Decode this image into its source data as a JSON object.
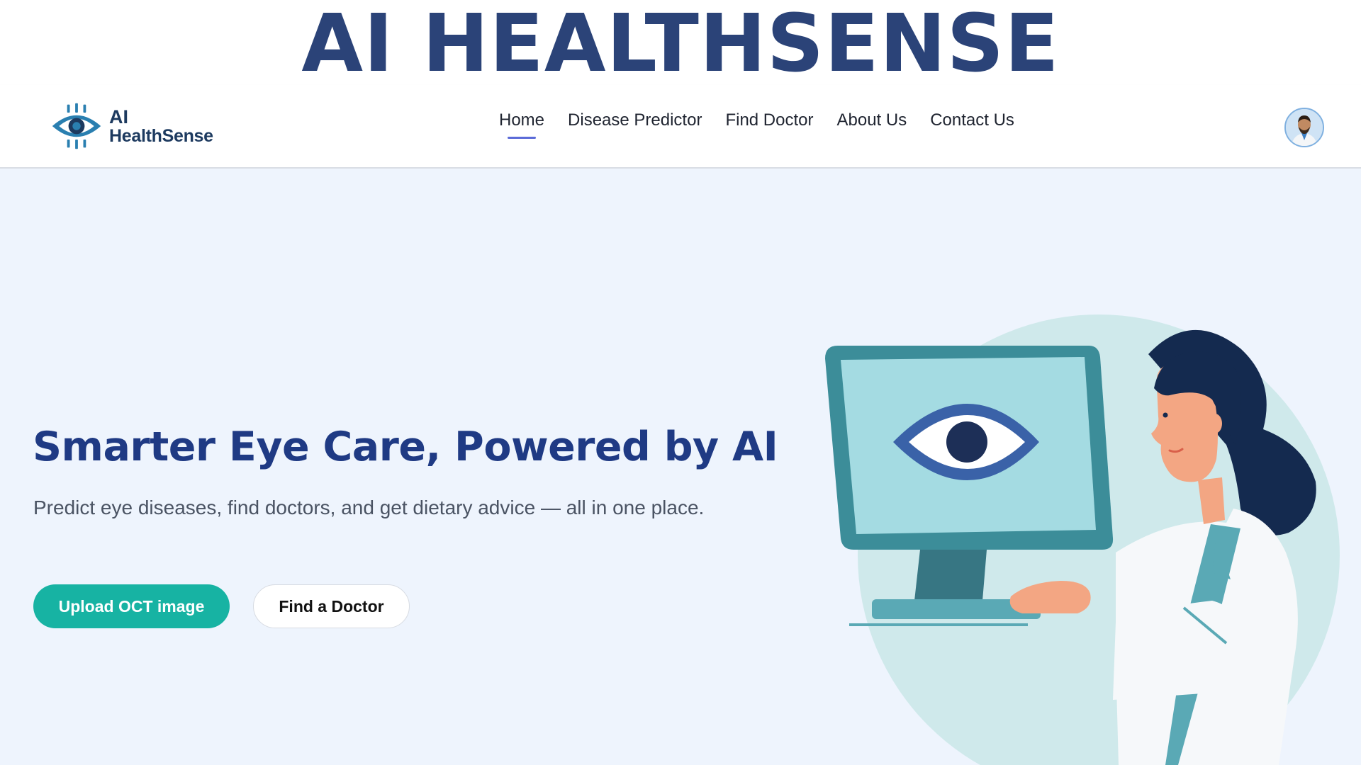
{
  "banner": {
    "title": "AI HEALTHSENSE"
  },
  "navbar": {
    "logo": {
      "line1": "AI",
      "line2": "HealthSense",
      "icon": "eye-chip-icon"
    },
    "links": [
      {
        "label": "Home",
        "active": true
      },
      {
        "label": "Disease Predictor",
        "active": false
      },
      {
        "label": "Find Doctor",
        "active": false
      },
      {
        "label": "About Us",
        "active": false
      },
      {
        "label": "Contact Us",
        "active": false
      }
    ],
    "avatar": {
      "icon": "user-avatar-icon"
    },
    "active_underline_color": "#5b6bd8"
  },
  "hero": {
    "title": "Smarter Eye Care, Powered by AI",
    "subtitle": "Predict eye diseases, find doctors, and get dietary advice — all in one place.",
    "primary_button": "Upload OCT image",
    "secondary_button": "Find a Doctor",
    "illustration": "doctor-at-monitor-illustration"
  },
  "colors": {
    "brand_navy": "#2b4378",
    "hero_title": "#1f3a84",
    "hero_background": "#eef4fd",
    "primary_button": "#17b3a3",
    "circle_background": "#cfe9eb"
  }
}
